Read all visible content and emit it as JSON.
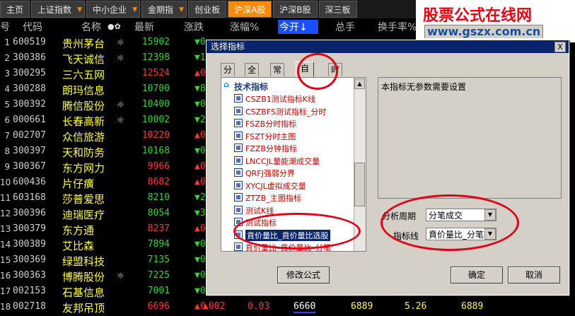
{
  "top_tabs": [
    {
      "label": "主页",
      "style": "normal",
      "dd": false
    },
    {
      "label": "上证指数",
      "style": "normal",
      "dd": true
    },
    {
      "label": "中小企业",
      "style": "normal",
      "dd": true
    },
    {
      "label": "金期指",
      "style": "normal",
      "dd": true
    },
    {
      "label": "创业板",
      "style": "normal",
      "dd": false
    },
    {
      "label": "沪深A股",
      "style": "active",
      "dd": false
    },
    {
      "label": "沪深B股",
      "style": "normal",
      "dd": false
    },
    {
      "label": "深三板",
      "style": "normal",
      "dd": false
    }
  ],
  "logo": {
    "line1": "股票公式在线网",
    "line2": "www.gszx.com.cn"
  },
  "columns": {
    "no": "号",
    "code": "代码",
    "name": "名称",
    "marks": "●✿",
    "price": "最新",
    "change": "涨跌",
    "pct": "涨幅%",
    "open": "今开↓",
    "total": "总手",
    "turnover": "换手率%"
  },
  "rows": [
    {
      "no": "1",
      "code": "600519",
      "name": "贵州茅台",
      "icon": "☼",
      "price": "15902",
      "chg": "▼0",
      "dir": "dn"
    },
    {
      "no": "2",
      "code": "300386",
      "name": "飞天诚信",
      "icon": "☼",
      "price": "12398",
      "chg": "▼1",
      "dir": "dn"
    },
    {
      "no": "3",
      "code": "300295",
      "name": "三六五网",
      "icon": "",
      "price": "12524",
      "chg": "▲0",
      "dir": "up"
    },
    {
      "no": "4",
      "code": "300288",
      "name": "朗玛信息",
      "icon": "",
      "price": "10700",
      "chg": "▼8",
      "dir": "dn"
    },
    {
      "no": "5",
      "code": "300392",
      "name": "腾信股份",
      "icon": "☼",
      "price": "10400",
      "chg": "▼0",
      "dir": "dn"
    },
    {
      "no": "6",
      "code": "000661",
      "name": "长春高新",
      "icon": "☼",
      "price": "10002",
      "chg": "▼2",
      "dir": "dn"
    },
    {
      "no": "7",
      "code": "002707",
      "name": "众信旅游",
      "icon": "",
      "price": "10220",
      "chg": "▲0",
      "dir": "up"
    },
    {
      "no": "8",
      "code": "300397",
      "name": "天和防务",
      "icon": "",
      "price": "10168",
      "chg": "▼0",
      "dir": "dn"
    },
    {
      "no": "9",
      "code": "300367",
      "name": "东方网力",
      "icon": "",
      "price": "9966",
      "chg": "▲0",
      "dir": "up"
    },
    {
      "no": "10",
      "code": "600436",
      "name": "片仔癀",
      "icon": "",
      "price": "8682",
      "chg": "▲0",
      "dir": "up"
    },
    {
      "no": "11",
      "code": "603168",
      "name": "莎普爱思",
      "icon": "",
      "price": "8210",
      "chg": "▼2",
      "dir": "dn"
    },
    {
      "no": "12",
      "code": "300396",
      "name": "迪瑞医疗",
      "icon": "",
      "price": "8054",
      "chg": "▼3",
      "dir": "dn"
    },
    {
      "no": "13",
      "code": "300379",
      "name": "东方通",
      "icon": "",
      "price": "8237",
      "chg": "▲0",
      "dir": "up"
    },
    {
      "no": "14",
      "code": "300389",
      "name": "艾比森",
      "icon": "",
      "price": "7894",
      "chg": "▼0",
      "dir": "dn"
    },
    {
      "no": "15",
      "code": "300369",
      "name": "绿盟科技",
      "icon": "",
      "price": "7135",
      "chg": "▼0",
      "dir": "dn"
    },
    {
      "no": "16",
      "code": "300363",
      "name": "博腾股份",
      "icon": "☼",
      "price": "7225",
      "chg": "▼0",
      "dir": "dn"
    },
    {
      "no": "17",
      "code": "002153",
      "name": "石基信息",
      "icon": "",
      "price": "7001",
      "chg": "▼0",
      "dir": "dn"
    },
    {
      "no": "18",
      "code": "002718",
      "name": "友邦吊顶",
      "icon": "",
      "price": "6696",
      "chg": "▲0",
      "dir": "up"
    }
  ],
  "bottom_row": {
    "no": "18",
    "code": "002718",
    "name": "友邦吊顶",
    "price": "6696",
    "chg": "▲002",
    "pct": "0.03",
    "open": "6660",
    "total": "6889",
    "extra1": "6889",
    "turnover": "5.26",
    "extra2": "6889"
  },
  "dialog": {
    "title": "选择指标",
    "close": "X",
    "tabs": [
      "分组",
      "全部",
      "常用",
      "自编",
      "时间"
    ],
    "tree_root": "技术指标",
    "tree_items": [
      "CSZB1测试指标K线",
      "CSZBFS测试指标_分时",
      "FSZB分时指标",
      "FSZT分时主图",
      "FZZB分钟指标",
      "LNCCJL量能潮成交量",
      "QRFJ强弱分界",
      "XYCJL虚拟成交量",
      "ZTZB_主图指标",
      "测试K线",
      "测试指标",
      "賁价量比_賁价量比选股",
      "賁价量比_賁价量比_分笔"
    ],
    "selected_index": 11,
    "description": "本指标无参数需要设置",
    "period_label": "分析周期",
    "period_value": "分笔成交",
    "indicator_label": "指标线",
    "indicator_value": "賁价量比_分笔",
    "edit_button": "修改公式",
    "ok_button": "确定",
    "cancel_button": "取消"
  },
  "colors": {
    "up": "#ff3a3a",
    "down": "#3ad03a",
    "name": "#ffff40",
    "accent": "#ff8a00",
    "highlight_ring": "#e0001a"
  }
}
